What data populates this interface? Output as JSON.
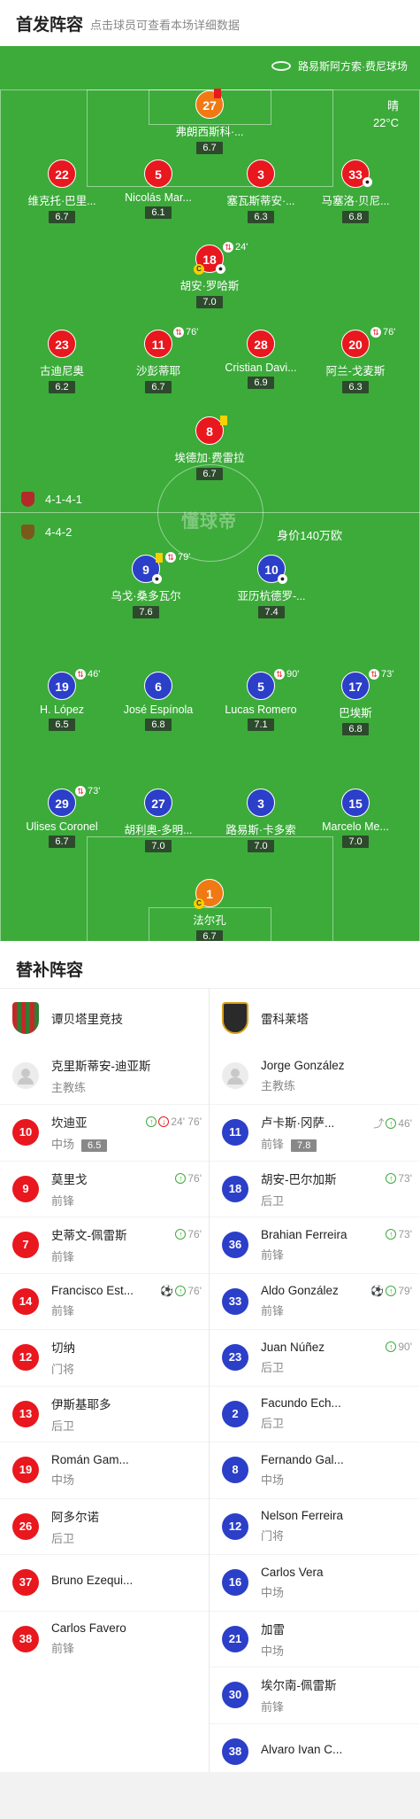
{
  "header": {
    "title": "首发阵容",
    "subtitle": "点击球员可查看本场详细数据"
  },
  "pitch": {
    "venue": "路易斯阿方索·费尼球场",
    "weather": "晴",
    "temperature": "22°C",
    "home_formation": "4-1-4-1",
    "away_formation": "4-4-2",
    "away_value": "身价140万欧",
    "watermark": "懂球帝",
    "home_players": [
      {
        "num": "27",
        "name": "弗朗西斯科·...",
        "rating": "6.7"
      },
      {
        "num": "22",
        "name": "维克托·巴里...",
        "rating": "6.7"
      },
      {
        "num": "5",
        "name": "Nicolás Mar...",
        "rating": "6.1"
      },
      {
        "num": "3",
        "name": "塞瓦斯蒂安·...",
        "rating": "6.3"
      },
      {
        "num": "33",
        "name": "马塞洛·贝尼...",
        "rating": "6.8"
      },
      {
        "num": "18",
        "name": "胡安·罗哈斯",
        "rating": "7.0",
        "event": "24'"
      },
      {
        "num": "23",
        "name": "古迪尼奥",
        "rating": "6.2"
      },
      {
        "num": "11",
        "name": "沙彭蒂耶",
        "rating": "6.7",
        "event": "76'"
      },
      {
        "num": "28",
        "name": "Cristian Davi...",
        "rating": "6.9"
      },
      {
        "num": "20",
        "name": "阿兰-戈麦斯",
        "rating": "6.3",
        "event": "76'"
      },
      {
        "num": "8",
        "name": "埃德加·费雷拉",
        "rating": "6.7"
      }
    ],
    "away_players": [
      {
        "num": "9",
        "name": "乌戈·桑多瓦尔",
        "rating": "7.6",
        "event": "79'"
      },
      {
        "num": "10",
        "name": "亚历杭德罗-...",
        "rating": "7.4"
      },
      {
        "num": "19",
        "name": "H. López",
        "rating": "6.5",
        "event": "46'"
      },
      {
        "num": "6",
        "name": "José Espínola",
        "rating": "6.8"
      },
      {
        "num": "5",
        "name": "Lucas Romero",
        "rating": "7.1",
        "event": "90'"
      },
      {
        "num": "17",
        "name": "巴埃斯",
        "rating": "6.8",
        "event": "73'"
      },
      {
        "num": "29",
        "name": "Ulises Coronel",
        "rating": "6.7",
        "event": "73'"
      },
      {
        "num": "27",
        "name": "胡利奥-多明...",
        "rating": "7.0"
      },
      {
        "num": "3",
        "name": "路易斯·卡多索",
        "rating": "7.0"
      },
      {
        "num": "15",
        "name": "Marcelo Me...",
        "rating": "7.0"
      },
      {
        "num": "1",
        "name": "法尔孔",
        "rating": "6.7"
      }
    ]
  },
  "subs": {
    "title": "替补阵容",
    "home": {
      "team": "谭贝塔里竞技",
      "coach": {
        "name": "克里斯蒂安-迪亚斯",
        "role": "主教练"
      },
      "players": [
        {
          "num": "10",
          "name": "坎迪亚",
          "pos": "中场",
          "rating": "6.5",
          "events": "24' 76'"
        },
        {
          "num": "9",
          "name": "莫里戈",
          "pos": "前锋",
          "events": "76'"
        },
        {
          "num": "7",
          "name": "史蒂文-佩雷斯",
          "pos": "前锋",
          "events": "76'"
        },
        {
          "num": "14",
          "name": "Francisco Est...",
          "pos": "前锋",
          "events": "76'"
        },
        {
          "num": "12",
          "name": "切纳",
          "pos": "门将"
        },
        {
          "num": "13",
          "name": "伊斯基耶多",
          "pos": "后卫"
        },
        {
          "num": "19",
          "name": "Román Gam...",
          "pos": "中场"
        },
        {
          "num": "26",
          "name": "阿多尔诺",
          "pos": "后卫"
        },
        {
          "num": "37",
          "name": "Bruno Ezequi...",
          "pos": ""
        },
        {
          "num": "38",
          "name": "Carlos Favero",
          "pos": "前锋"
        }
      ]
    },
    "away": {
      "team": "雷科莱塔",
      "coach": {
        "name": "Jorge González",
        "role": "主教练"
      },
      "players": [
        {
          "num": "11",
          "name": "卢卡斯·冈萨...",
          "pos": "前锋",
          "rating": "7.8",
          "events": "46'"
        },
        {
          "num": "18",
          "name": "胡安-巴尔加斯",
          "pos": "后卫",
          "events": "73'"
        },
        {
          "num": "36",
          "name": "Brahian Ferreira",
          "pos": "前锋",
          "events": "73'"
        },
        {
          "num": "33",
          "name": "Aldo González",
          "pos": "前锋",
          "events": "79'"
        },
        {
          "num": "23",
          "name": "Juan Núñez",
          "pos": "后卫",
          "events": "90'"
        },
        {
          "num": "2",
          "name": "Facundo Ech...",
          "pos": "后卫"
        },
        {
          "num": "8",
          "name": "Fernando Gal...",
          "pos": "中场"
        },
        {
          "num": "12",
          "name": "Nelson Ferreira",
          "pos": "门将"
        },
        {
          "num": "16",
          "name": "Carlos Vera",
          "pos": "中场"
        },
        {
          "num": "21",
          "name": "加雷",
          "pos": "中场"
        },
        {
          "num": "30",
          "name": "埃尔南-佩雷斯",
          "pos": "前锋"
        },
        {
          "num": "38",
          "name": "Alvaro Ivan C...",
          "pos": ""
        }
      ]
    }
  },
  "colors": {
    "pitch": "#3cab3a",
    "home": "#e9171e",
    "away": "#2b3fc9",
    "keeper": "#f07913"
  }
}
